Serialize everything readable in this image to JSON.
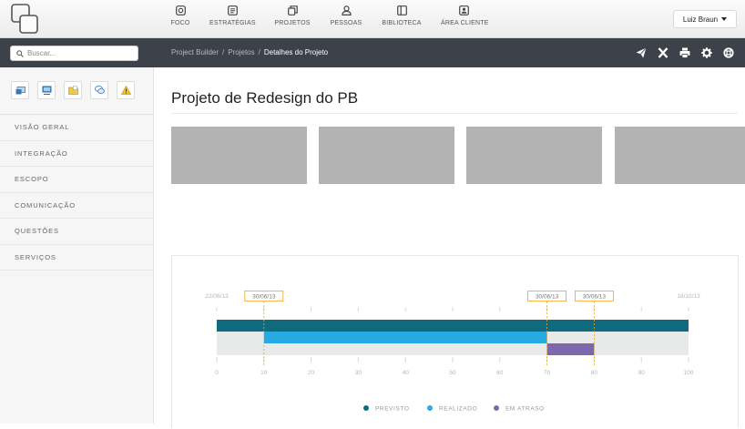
{
  "nav": {
    "items": [
      {
        "label": "FOCO",
        "icon": "focus-icon"
      },
      {
        "label": "ESTRATÉGIAS",
        "icon": "strategy-icon"
      },
      {
        "label": "PROJETOS",
        "icon": "projects-icon"
      },
      {
        "label": "PESSOAS",
        "icon": "people-icon"
      },
      {
        "label": "BIBLIOTECA",
        "icon": "library-icon"
      },
      {
        "label": "ÁREA CLIENTE",
        "icon": "client-area-icon"
      }
    ],
    "user_name": "Luiz Braun"
  },
  "search": {
    "placeholder": "Buscar..."
  },
  "breadcrumb": {
    "items": [
      "Project Builder",
      "Projetos"
    ],
    "current": "Detalhes do Projeto",
    "separator": "/"
  },
  "sidebar": {
    "quick_icons": [
      "monitor-icon",
      "presentation-icon",
      "folder-icon",
      "chat-icon",
      "warning-icon"
    ],
    "items": [
      {
        "label": "VISÃO GERAL"
      },
      {
        "label": "INTEGRAÇÃO"
      },
      {
        "label": "ESCOPO"
      },
      {
        "label": "COMUNICAÇÃO"
      },
      {
        "label": "QUESTÕES"
      },
      {
        "label": "SERVIÇOS"
      }
    ]
  },
  "page": {
    "title": "Projeto de Redesign do PB"
  },
  "colors": {
    "previsto": "#0e6a7c",
    "realizado": "#27a9e1",
    "em_atraso": "#7d67ae",
    "marker": "#f0a422",
    "track": "#e8eaea"
  },
  "chart_data": {
    "type": "gantt",
    "xlim": [
      0,
      100
    ],
    "x_ticks": [
      0,
      10,
      20,
      30,
      40,
      50,
      60,
      70,
      80,
      90,
      100
    ],
    "start_label": "22/06/13",
    "end_label": "18/10/13",
    "markers": [
      {
        "x": 10,
        "label": "30/06/13"
      },
      {
        "x": 70,
        "label": "30/06/13"
      },
      {
        "x": 80,
        "label": "30/06/13"
      }
    ],
    "series": [
      {
        "name": "PREVISTO",
        "start": 0,
        "end": 100,
        "color": "#0e6a7c"
      },
      {
        "name": "REALIZADO",
        "start": 10,
        "end": 70,
        "color": "#27a9e1"
      },
      {
        "name": "EM ATRASO",
        "start": 70,
        "end": 80,
        "color": "#7d67ae"
      }
    ],
    "legend_position": "bottom"
  }
}
